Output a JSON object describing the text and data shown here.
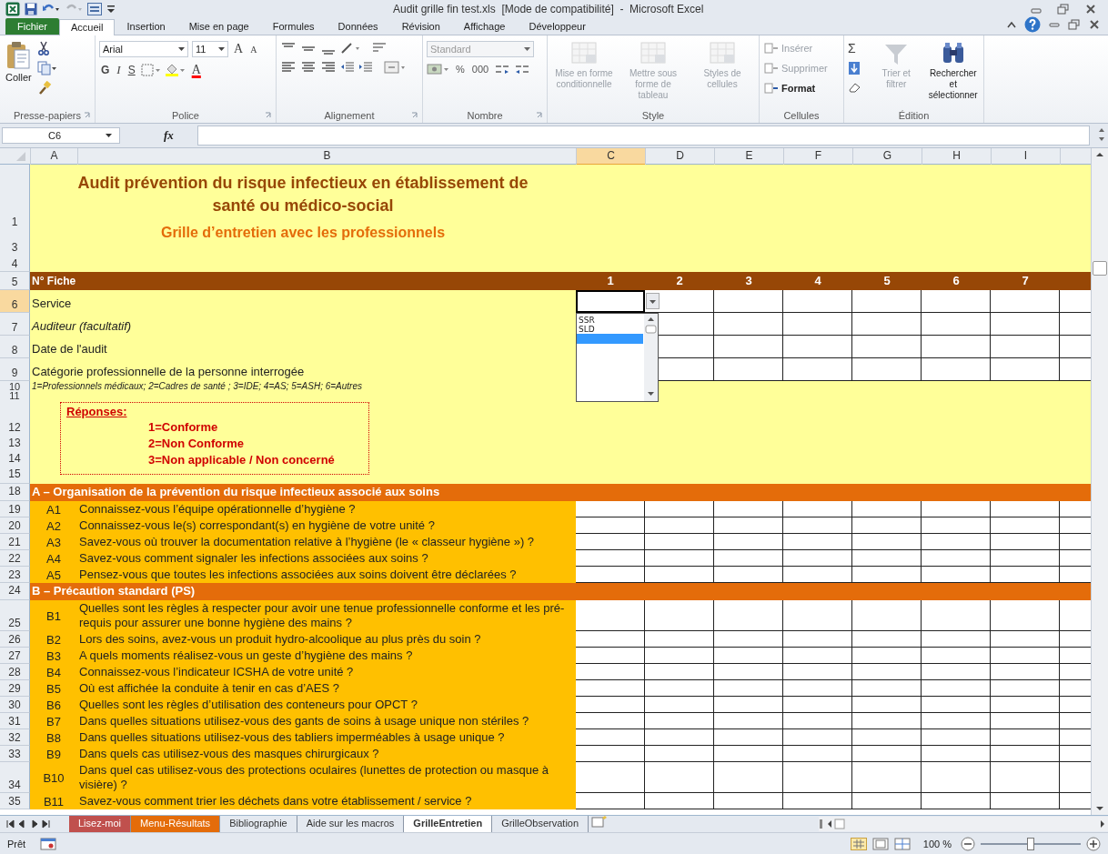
{
  "window": {
    "title": "Audit grille fin test.xls  [Mode de compatibilité]  -  Microsoft Excel"
  },
  "ribbon_tabs": [
    {
      "label": "Fichier",
      "kind": "file",
      "selected": false
    },
    {
      "label": "Accueil",
      "kind": "tab",
      "selected": true
    },
    {
      "label": "Insertion",
      "kind": "tab",
      "selected": false
    },
    {
      "label": "Mise en page",
      "kind": "tab",
      "selected": false
    },
    {
      "label": "Formules",
      "kind": "tab",
      "selected": false
    },
    {
      "label": "Données",
      "kind": "tab",
      "selected": false
    },
    {
      "label": "Révision",
      "kind": "tab",
      "selected": false
    },
    {
      "label": "Affichage",
      "kind": "tab",
      "selected": false
    },
    {
      "label": "Développeur",
      "kind": "tab",
      "selected": false
    }
  ],
  "clipboard": {
    "label": "Presse-papiers",
    "paste": "Coller"
  },
  "font": {
    "label": "Police",
    "family": "Arial",
    "size": "11",
    "grow": "A",
    "shrink": "A",
    "bold": "G",
    "italic": "I",
    "underline": "S",
    "color_letter": "A"
  },
  "alignment": {
    "label": "Alignement"
  },
  "number": {
    "label": "Nombre",
    "format": "Standard",
    "percent": "%",
    "thousands": "000"
  },
  "style": {
    "label": "Style",
    "buttons": [
      {
        "label": "Mise en forme conditionnelle",
        "disabled": true
      },
      {
        "label": "Mettre sous forme de tableau",
        "disabled": true
      },
      {
        "label": "Styles de cellules",
        "disabled": true
      }
    ]
  },
  "cells": {
    "label": "Cellules",
    "buttons": [
      {
        "label": "Insérer",
        "disabled": true
      },
      {
        "label": "Supprimer",
        "disabled": true
      },
      {
        "label": "Format",
        "disabled": false
      }
    ]
  },
  "editing": {
    "label": "Édition",
    "autosum": "Σ",
    "buttons": [
      {
        "label": "Trier et filtrer",
        "disabled": true
      },
      {
        "label": "Rechercher et sélectionner",
        "disabled": false
      }
    ]
  },
  "formula_bar": {
    "name_box": "C6",
    "function_label": "fx"
  },
  "sheet": {
    "columns": [
      {
        "label": "A",
        "selected": false
      },
      {
        "label": "B",
        "selected": false
      },
      {
        "label": "C",
        "selected": true
      },
      {
        "label": "D",
        "selected": false
      },
      {
        "label": "E",
        "selected": false
      },
      {
        "label": "F",
        "selected": false
      },
      {
        "label": "G",
        "selected": false
      },
      {
        "label": "H",
        "selected": false
      },
      {
        "label": "I",
        "selected": false
      }
    ],
    "title": {
      "rows": [
        "1",
        "3",
        "4"
      ],
      "heading": "Audit prévention du risque infectieux en établissement de santé ou médico-social",
      "subheading": "Grille d’entretien avec les professionnels"
    },
    "fiche": {
      "row": "5",
      "label": "N° Fiche",
      "numbers": [
        "1",
        "2",
        "3",
        "4",
        "5",
        "6",
        "7"
      ]
    },
    "fields": [
      {
        "row": "6",
        "label": "Service",
        "italic": false,
        "selected": true
      },
      {
        "row": "7",
        "label": "Auditeur (facultatif)",
        "italic": true,
        "selected": false
      },
      {
        "row": "8",
        "label": "Date de l'audit",
        "italic": false,
        "selected": false
      },
      {
        "row": "9",
        "label": "Catégorie professionnelle de la personne interrogée",
        "italic": false,
        "selected": false
      }
    ],
    "note": {
      "row": "10",
      "text": "1=Professionnels médicaux; 2=Cadres de santé ; 3=IDE; 4=AS; 5=ASH; 6=Autres"
    },
    "gap_row": "11",
    "legend": {
      "rows": [
        "12",
        "13",
        "14",
        "15"
      ],
      "title": "Réponses:",
      "lines": [
        "1=Conforme",
        "2=Non Conforme",
        "3=Non applicable / Non concerné"
      ]
    },
    "dropdown": {
      "options": [
        {
          "label": "SSR",
          "selected": false
        },
        {
          "label": "SLD",
          "selected": false
        }
      ],
      "blank_option_selected": true
    },
    "sections": [
      {
        "row": "18",
        "title": "A – Organisation de la prévention du risque infectieux associé aux soins",
        "questions": [
          {
            "row": "19",
            "code": "A1",
            "text": "Connaissez-vous l’équipe opérationnelle d’hygiène ?"
          },
          {
            "row": "20",
            "code": "A2",
            "text": "Connaissez-vous le(s) correspondant(s) en hygiène de votre unité ?"
          },
          {
            "row": "21",
            "code": "A3",
            "text": "Savez-vous où trouver la documentation relative à l’hygiène (le « classeur hygiène ») ?"
          },
          {
            "row": "22",
            "code": "A4",
            "text": "Savez-vous comment signaler les infections associées aux soins ?"
          },
          {
            "row": "23",
            "code": "A5",
            "text": "Pensez-vous que toutes les infections associées aux soins doivent être déclarées ?"
          }
        ]
      },
      {
        "row": "24",
        "title": "B – Précaution standard (PS)",
        "questions": [
          {
            "row": "25",
            "code": "B1",
            "text": "Quelles sont les règles à respecter pour avoir une tenue professionnelle conforme et les pré-requis pour assurer une bonne hygiène des mains ?"
          },
          {
            "row": "26",
            "code": "B2",
            "text": "Lors des soins, avez-vous un produit hydro-alcoolique au plus près du soin ?"
          },
          {
            "row": "27",
            "code": "B3",
            "text": "A quels moments réalisez-vous un geste d’hygiène des mains ?"
          },
          {
            "row": "28",
            "code": "B4",
            "text": "Connaissez-vous l’indicateur ICSHA de votre unité ?"
          },
          {
            "row": "29",
            "code": "B5",
            "text": "Où est affichée la conduite à tenir en cas d’AES ?"
          },
          {
            "row": "30",
            "code": "B6",
            "text": "Quelles sont les règles d’utilisation des conteneurs pour OPCT ?"
          },
          {
            "row": "31",
            "code": "B7",
            "text": "Dans quelles situations utilisez-vous des gants de soins à usage unique non stériles ?"
          },
          {
            "row": "32",
            "code": "B8",
            "text": "Dans quelles situations utilisez-vous des tabliers imperméables à usage unique ?"
          },
          {
            "row": "33",
            "code": "B9",
            "text": "Dans quels cas utilisez-vous des masques chirurgicaux ?"
          },
          {
            "row": "34",
            "code": "B10",
            "text": "Dans quel cas utilisez-vous des protections oculaires (lunettes de protection ou masque à visière) ?"
          },
          {
            "row": "35",
            "code": "B11",
            "text": "Savez-vous comment trier les déchets dans votre établissement / service ?"
          }
        ]
      }
    ]
  },
  "sheet_tabs": [
    {
      "label": "Lisez-moi",
      "selected": false,
      "color": "#c0504d"
    },
    {
      "label": "Menu-Résultats",
      "selected": false,
      "color": "#e46c0a"
    },
    {
      "label": "Bibliographie",
      "selected": false
    },
    {
      "label": "Aide sur les macros",
      "selected": false
    },
    {
      "label": "GrilleEntretien",
      "selected": true
    },
    {
      "label": "GrilleObservation",
      "selected": false
    }
  ],
  "status_bar": {
    "mode": "Prêt",
    "zoom": "100 %",
    "zoom_slider": {
      "level": 0.5
    }
  }
}
